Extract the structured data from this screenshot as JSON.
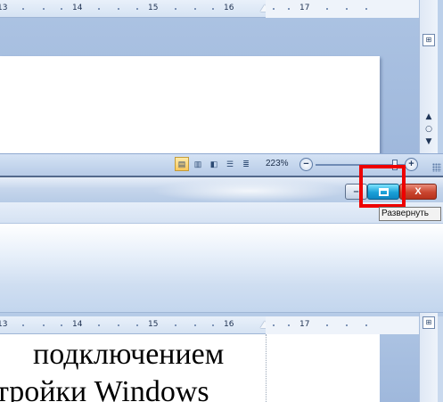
{
  "top_window": {
    "ruler": {
      "ticks": [
        "13",
        "14",
        "15",
        "16",
        "17"
      ]
    },
    "status_bar": {
      "view_buttons": [
        "print-layout",
        "full-screen-reading",
        "web-layout",
        "outline",
        "draft"
      ],
      "zoom_label": "223%",
      "zoom_out": "−",
      "zoom_in": "+"
    },
    "scrollbar": {
      "prev_page": "▲",
      "select_browse": "○",
      "next_page": "▼"
    }
  },
  "bottom_window": {
    "caption_buttons": {
      "minimize": "–",
      "maximize": "",
      "close": "X"
    },
    "tooltip": "Развернуть",
    "ruler": {
      "ticks": [
        "13",
        "14",
        "15",
        "16",
        "17"
      ]
    },
    "document_lines": [
      "подключением",
      "тройки Windows"
    ]
  },
  "colors": {
    "highlight": "#ee0000",
    "maximize_button": "#1aa1d8",
    "close_button": "#c9452f"
  }
}
